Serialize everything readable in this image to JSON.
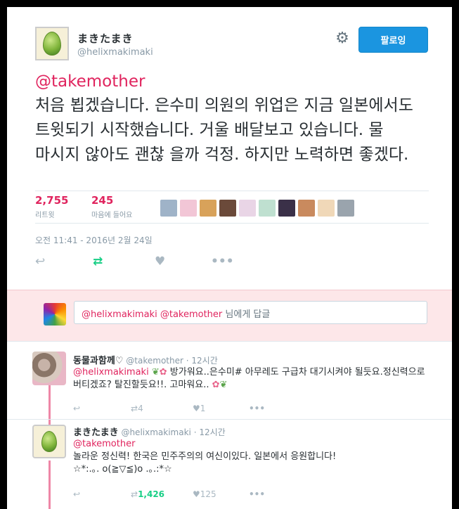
{
  "author": {
    "name": "まきたまき",
    "handle": "@helixmakimaki",
    "follow_label": "팔로잉"
  },
  "tweet": {
    "mention": "@takemother",
    "text": "처음 뵙겠습니다. 은수미 의원의 위업은 지금 일본에서도 트윗되기 시작했습니다. 거울 배달보고 있습니다. 물 마시지 않아도 괜찮 을까 걱정. 하지만 노력하면 좋겠다.",
    "retweets": "2,755",
    "retweets_label": "리트윗",
    "likes": "245",
    "likes_label": "마음에 들어요",
    "timestamp": "오전 11:41 - 2016년 2월 24일"
  },
  "likers": [
    "#9fb3c8",
    "#f2c6d6",
    "#d8a25a",
    "#6b4a3a",
    "#e9d5e6",
    "#bfe0d0",
    "#3a3048",
    "#c98a5e",
    "#f0d8b8",
    "#9aa4ad"
  ],
  "reply_box": {
    "mention1": "@helixmakimaki",
    "mention2": "@takemother",
    "suffix": "님에게 답글"
  },
  "replies": [
    {
      "name": "동물과함께♡",
      "handle": "@takemother",
      "time": "12시간",
      "mention": "@helixmakimaki",
      "text1": "방가워요..은수미# 아무레도 구급차 대기시켜야 될듯요.정신력으로 버티겠죠? 탈진할듯요!!. 고마워요..",
      "retweets": "4",
      "likes": "1"
    },
    {
      "name": "まきたまき",
      "handle": "@helixmakimaki",
      "time": "12시간",
      "mention": "@takemother",
      "line1": "놀라운 정신력! 한국은 민주주의의 여신이있다. 일본에서 응원합니다!",
      "line2": "☆*:.｡. o(≧▽≦)o .｡.:*☆",
      "retweets": "1,426",
      "likes": "125"
    }
  ],
  "colors": {
    "accent": "#e0245e",
    "follow": "#1b95e0",
    "retweet": "#19cf86"
  }
}
